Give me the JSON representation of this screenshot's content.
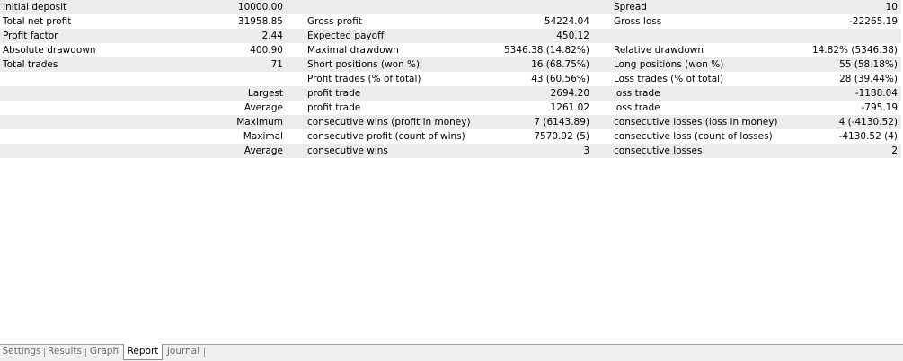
{
  "rows": [
    {
      "c1": "Initial deposit",
      "c2": "10000.00",
      "c3": "",
      "c4": "",
      "c5": "Spread",
      "c6": "10"
    },
    {
      "c1": "Total net profit",
      "c2": "31958.85",
      "c3": "Gross profit",
      "c4": "54224.04",
      "c5": "Gross loss",
      "c6": "-22265.19"
    },
    {
      "c1": "Profit factor",
      "c2": "2.44",
      "c3": "Expected payoff",
      "c4": "450.12",
      "c5": "",
      "c6": ""
    },
    {
      "c1": "Absolute drawdown",
      "c2": "400.90",
      "c3": "Maximal drawdown",
      "c4": "5346.38 (14.82%)",
      "c5": "Relative drawdown",
      "c6": "14.82% (5346.38)"
    },
    {
      "c1": "Total trades",
      "c2": "71",
      "c3": "Short positions (won %)",
      "c4": "16 (68.75%)",
      "c5": "Long positions (won %)",
      "c6": "55 (58.18%)"
    },
    {
      "c1": "",
      "c2": "",
      "c3": "Profit trades (% of total)",
      "c4": "43 (60.56%)",
      "c5": "Loss trades (% of total)",
      "c6": "28 (39.44%)"
    },
    {
      "c1": "",
      "c2": "Largest",
      "c3": "profit trade",
      "c4": "2694.20",
      "c5": "loss trade",
      "c6": "-1188.04"
    },
    {
      "c1": "",
      "c2": "Average",
      "c3": "profit trade",
      "c4": "1261.02",
      "c5": "loss trade",
      "c6": "-795.19"
    },
    {
      "c1": "",
      "c2": "Maximum",
      "c3": "consecutive wins (profit in money)",
      "c4": "7 (6143.89)",
      "c5": "consecutive losses (loss in money)",
      "c6": "4 (-4130.52)"
    },
    {
      "c1": "",
      "c2": "Maximal",
      "c3": "consecutive profit (count of wins)",
      "c4": "7570.92 (5)",
      "c5": "consecutive loss (count of losses)",
      "c6": "-4130.52 (4)"
    },
    {
      "c1": "",
      "c2": "Average",
      "c3": "consecutive wins",
      "c4": "3",
      "c5": "consecutive losses",
      "c6": "2"
    }
  ],
  "tabs": [
    {
      "label": "Settings",
      "active": false
    },
    {
      "label": "Results",
      "active": false
    },
    {
      "label": "Graph",
      "active": false
    },
    {
      "label": "Report",
      "active": true
    },
    {
      "label": "Journal",
      "active": false
    }
  ]
}
